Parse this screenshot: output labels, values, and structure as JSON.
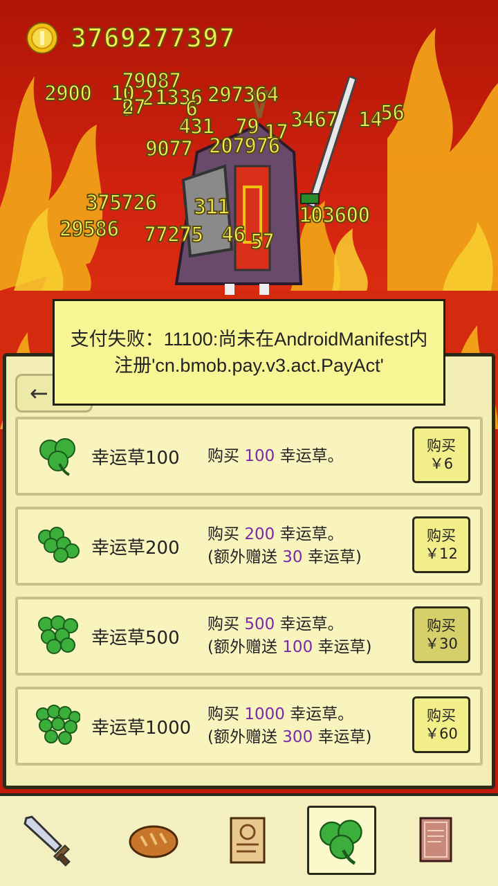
{
  "coins": "3769277397",
  "damage_numbers": [
    "2900",
    "10",
    "79087",
    "2",
    "1336",
    "297364",
    "431",
    "79",
    "17",
    "3467",
    "14",
    "56",
    "9077",
    "207976",
    "375726",
    "311",
    "103600",
    "29586",
    "77275",
    "46",
    "57",
    "27",
    "9",
    "6"
  ],
  "toast": {
    "text": "支付失败：11100:尚未在AndroidManifest内注册'cn.bmob.pay.v3.act.PayAct'"
  },
  "back_label": "←",
  "shop": {
    "items": [
      {
        "name": "幸运草100",
        "line1_pre": "购买 ",
        "line1_num": "100",
        "line1_post": " 幸运草。",
        "line2_pre": "",
        "line2_num": "",
        "line2_post": "",
        "buy": "购买",
        "price": "￥6"
      },
      {
        "name": "幸运草200",
        "line1_pre": "购买 ",
        "line1_num": "200",
        "line1_post": " 幸运草。",
        "line2_pre": "(额外赠送 ",
        "line2_num": "30",
        "line2_post": " 幸运草)",
        "buy": "购买",
        "price": "￥12"
      },
      {
        "name": "幸运草500",
        "line1_pre": "购买 ",
        "line1_num": "500",
        "line1_post": " 幸运草。",
        "line2_pre": "(额外赠送 ",
        "line2_num": "100",
        "line2_post": " 幸运草)",
        "buy": "购买",
        "price": "￥30"
      },
      {
        "name": "幸运草1000",
        "line1_pre": "购买 ",
        "line1_num": "1000",
        "line1_post": " 幸运草。",
        "line2_pre": "(额外赠送 ",
        "line2_num": "300",
        "line2_post": " 幸运草)",
        "buy": "购买",
        "price": "￥60"
      }
    ]
  },
  "tabs": [
    {
      "icon": "sword-icon"
    },
    {
      "icon": "bread-icon"
    },
    {
      "icon": "scroll-icon"
    },
    {
      "icon": "clover-icon",
      "active": true
    },
    {
      "icon": "book-icon"
    }
  ],
  "colors": {
    "accent_purple": "#7a2aa8",
    "damage_yellow": "#f6f456",
    "panel_bg": "#f3eeb5",
    "fire_red": "#c21a0a"
  }
}
